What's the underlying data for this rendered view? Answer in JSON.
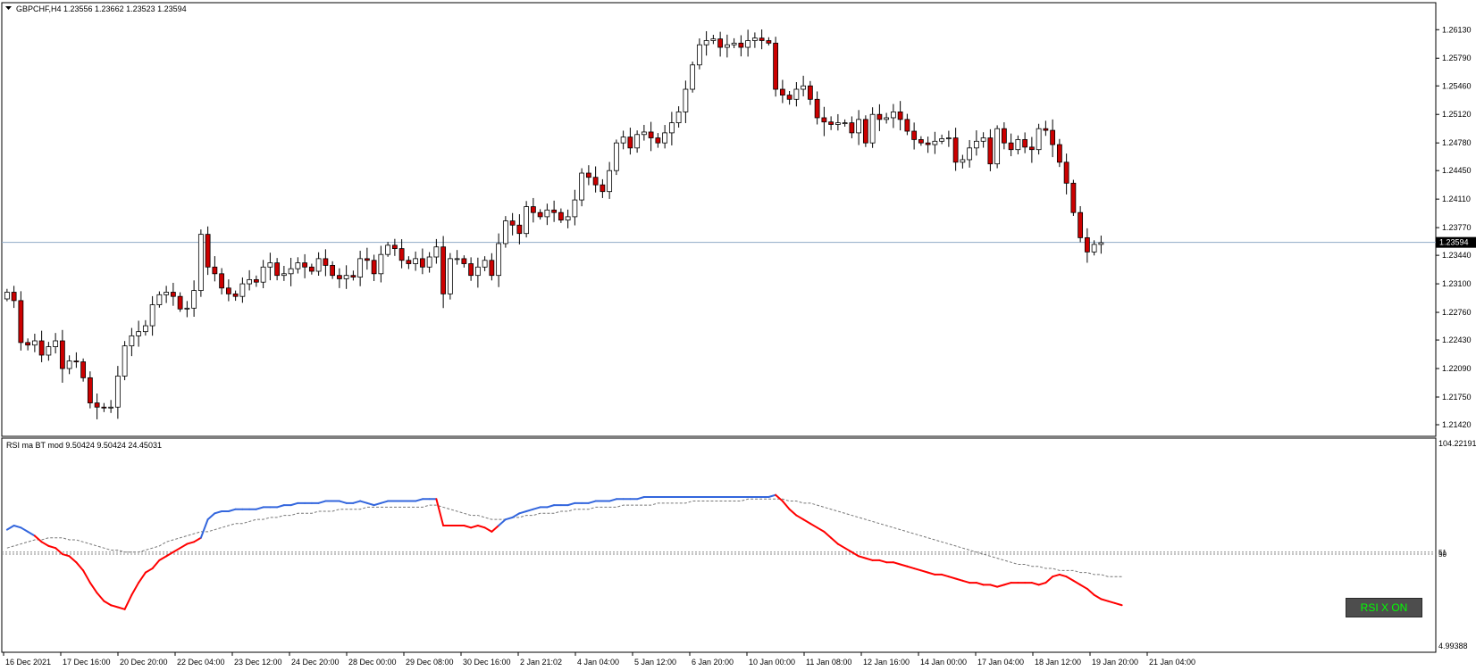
{
  "main_header": "GBPCHF,H4  1.23556 1.23662 1.23523 1.23594",
  "rsi_header": "RSI ma BT mod 9.50424 9.50424 24.45031",
  "current_price_label": "1.23594",
  "rsi_button_label": "RSI X ON",
  "rsi_levels_text": [
    "51",
    "50"
  ],
  "colors": {
    "bull_candle": "#ffffff",
    "bear_candle": "#cc0000",
    "current_price_line": "#8fa9c6",
    "rsi_up": "#3366dd",
    "rsi_down": "#ff0000",
    "rsi_ma": "#777777",
    "button_text": "#00ff00"
  },
  "chart_data": [
    {
      "type": "candlestick",
      "title": "GBPCHF,H4",
      "ohlc_header": [
        1.23556,
        1.23662,
        1.23523,
        1.23594
      ],
      "y_ticks": [
        "1.26130",
        "1.25790",
        "1.25460",
        "1.25120",
        "1.24780",
        "1.24450",
        "1.24110",
        "1.23770",
        "1.23440",
        "1.23100",
        "1.22760",
        "1.22430",
        "1.22090",
        "1.21750",
        "1.21420"
      ],
      "ylim": [
        1.2142,
        1.2625
      ],
      "current_price": 1.23594,
      "x_ticks": [
        "16 Dec 2021",
        "17 Dec 16:00",
        "20 Dec 20:00",
        "22 Dec 04:00",
        "23 Dec 12:00",
        "24 Dec 20:00",
        "28 Dec 00:00",
        "29 Dec 08:00",
        "30 Dec 16:00",
        "2 Jan 21:02",
        "4 Jan 04:00",
        "5 Jan 12:00",
        "6 Jan 20:00",
        "10 Jan 00:00",
        "11 Jan 08:00",
        "12 Jan 16:00",
        "14 Jan 00:00",
        "17 Jan 04:00",
        "18 Jan 12:00",
        "19 Jan 20:00",
        "21 Jan 04:00"
      ],
      "closes": [
        1.23,
        1.229,
        1.224,
        1.2237,
        1.2242,
        1.2225,
        1.2235,
        1.2242,
        1.2209,
        1.2218,
        1.2217,
        1.2198,
        1.2168,
        1.2163,
        1.2162,
        1.2163,
        1.22,
        1.2236,
        1.2248,
        1.2253,
        1.226,
        1.2285,
        1.2297,
        1.23,
        1.2295,
        1.228,
        1.2281,
        1.2302,
        1.2369,
        1.233,
        1.2322,
        1.2305,
        1.2298,
        1.2295,
        1.231,
        1.2315,
        1.2312,
        1.233,
        1.2335,
        1.232,
        1.2322,
        1.2328,
        1.2335,
        1.233,
        1.2325,
        1.234,
        1.2332,
        1.232,
        1.2316,
        1.232,
        1.2318,
        1.234,
        1.2338,
        1.2322,
        1.2345,
        1.2356,
        1.2352,
        1.2338,
        1.2334,
        1.234,
        1.233,
        1.2342,
        1.2354,
        1.2298,
        1.234,
        1.234,
        1.2334,
        1.232,
        1.233,
        1.2338,
        1.232,
        1.2358,
        1.2385,
        1.238,
        1.237,
        1.2402,
        1.2395,
        1.239,
        1.2398,
        1.2395,
        1.2386,
        1.239,
        1.241,
        1.2442,
        1.2437,
        1.2428,
        1.242,
        1.2445,
        1.2478,
        1.2485,
        1.2472,
        1.2488,
        1.2491,
        1.2484,
        1.2478,
        1.249,
        1.2502,
        1.2515,
        1.2542,
        1.2571,
        1.2595,
        1.26,
        1.2602,
        1.2592,
        1.2595,
        1.2597,
        1.2592,
        1.26,
        1.2603,
        1.26,
        1.2597,
        1.2542,
        1.2535,
        1.253,
        1.2542,
        1.2546,
        1.253,
        1.2508,
        1.2503,
        1.25,
        1.2502,
        1.2502,
        1.249,
        1.2506,
        1.2478,
        1.2512,
        1.2506,
        1.2508,
        1.2515,
        1.2506,
        1.2492,
        1.2482,
        1.2478,
        1.2476,
        1.248,
        1.2483,
        1.2484,
        1.2455,
        1.2458,
        1.2472,
        1.248,
        1.2484,
        1.2453,
        1.2495,
        1.2478,
        1.247,
        1.2482,
        1.2473,
        1.247,
        1.2495,
        1.2493,
        1.2476,
        1.2455,
        1.243,
        1.2395,
        1.2365,
        1.2348,
        1.2357,
        1.2359
      ]
    },
    {
      "type": "line",
      "title": "RSI ma BT mod",
      "header_values": [
        9.50424,
        9.50424,
        24.45031
      ],
      "y_ticks": [
        "104.22191",
        "4.99388"
      ],
      "ylim": [
        4.99388,
        104.22191
      ],
      "levels": [
        51,
        50
      ],
      "series": [
        {
          "name": "RSI",
          "values": [
            62,
            64,
            63,
            61,
            59,
            56,
            54,
            53,
            50,
            49,
            46,
            42,
            36,
            31,
            27,
            25,
            24,
            23,
            30,
            36,
            41,
            43,
            47,
            49,
            51,
            53,
            55,
            56,
            58,
            67,
            70,
            71,
            71,
            72,
            72,
            72,
            72,
            73,
            73,
            73,
            74,
            74,
            75,
            75,
            75,
            75,
            76,
            76,
            76,
            75,
            75,
            76,
            75,
            74,
            75,
            76,
            76,
            76,
            76,
            76,
            77,
            77,
            77,
            64,
            64,
            64,
            64,
            63,
            64,
            63,
            61,
            64,
            67,
            68,
            70,
            71,
            72,
            73,
            73,
            74,
            74,
            74,
            75,
            75,
            75,
            76,
            76,
            76,
            77,
            77,
            77,
            77,
            78,
            78,
            78,
            78,
            78,
            78,
            78,
            78,
            78,
            78,
            78,
            78,
            78,
            78,
            78,
            78,
            78,
            78,
            78,
            79,
            76,
            72,
            69,
            67,
            65,
            63,
            61,
            58,
            55,
            53,
            51,
            49,
            48,
            47,
            47,
            46,
            46,
            45,
            44,
            43,
            42,
            41,
            40,
            40,
            39,
            38,
            37,
            36,
            36,
            35,
            35,
            34,
            35,
            36,
            36,
            36,
            36,
            35,
            36,
            39,
            40,
            39,
            37,
            35,
            33,
            30,
            28,
            27,
            26,
            25
          ]
        },
        {
          "name": "RSI MA",
          "values": [
            53,
            54,
            55,
            56,
            57,
            57,
            58,
            58,
            58,
            57,
            57,
            56,
            55,
            54,
            53,
            52,
            52,
            51,
            51,
            51,
            52,
            53,
            54,
            56,
            57,
            58,
            59,
            60,
            61,
            61,
            62,
            63,
            64,
            65,
            65,
            66,
            67,
            67,
            68,
            68,
            69,
            69,
            70,
            70,
            70,
            71,
            71,
            71,
            72,
            72,
            72,
            72,
            73,
            73,
            73,
            73,
            73,
            73,
            73,
            73,
            73,
            74,
            74,
            73,
            72,
            71,
            70,
            69,
            69,
            68,
            67,
            67,
            67,
            68,
            68,
            69,
            69,
            70,
            70,
            70,
            71,
            71,
            72,
            72,
            72,
            73,
            73,
            73,
            73,
            74,
            74,
            74,
            74,
            74,
            75,
            75,
            75,
            75,
            75,
            76,
            76,
            76,
            76,
            76,
            76,
            76,
            76,
            77,
            77,
            77,
            77,
            77,
            77,
            76,
            76,
            75,
            75,
            74,
            73,
            72,
            71,
            70,
            69,
            68,
            67,
            66,
            65,
            64,
            63,
            62,
            61,
            60,
            59,
            58,
            57,
            56,
            55,
            54,
            53,
            52,
            51,
            50,
            49,
            48,
            47,
            46,
            45,
            45,
            44,
            44,
            43,
            43,
            42,
            42,
            42,
            41,
            41,
            40,
            40,
            39,
            39,
            39
          ]
        }
      ]
    }
  ]
}
